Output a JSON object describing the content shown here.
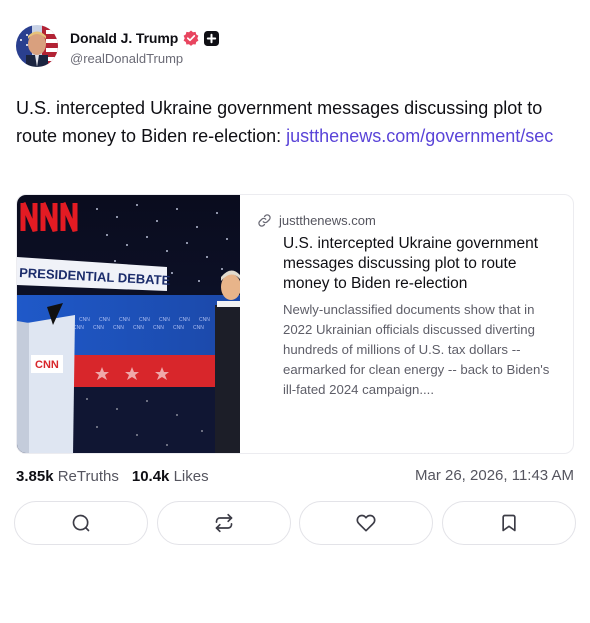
{
  "author": {
    "name": "Donald J. Trump",
    "handle": "@realDonaldTrump",
    "verified_color": "#e8455f"
  },
  "post": {
    "text": "U.S. intercepted Ukraine government messages discussing plot to route money to Biden re-election: ",
    "link_text": "justthenews.com/government/sec",
    "link_color": "#5a44d8"
  },
  "card": {
    "domain": "justthenews.com",
    "title": "U.S. intercepted Ukraine government messages discussing plot to route money to Biden re-election",
    "description": "Newly-unclassified documents show that in 2022 Ukrainian officials discussed diverting hundreds of millions of U.S. tax dollars -- earmarked for clean energy -- back to Biden's ill-fated 2024 campaign....",
    "image_text": {
      "debate_banner": "PRESIDENTIAL DEBATE",
      "network_logo": "CNN"
    }
  },
  "stats": {
    "retruths_count": "3.85k",
    "retruths_label": "ReTruths",
    "likes_count": "10.4k",
    "likes_label": "Likes",
    "timestamp": "Mar 26, 2026, 11:43 AM"
  },
  "actions": [
    {
      "icon": "comment-icon"
    },
    {
      "icon": "retruth-icon"
    },
    {
      "icon": "heart-icon"
    },
    {
      "icon": "bookmark-icon"
    }
  ]
}
